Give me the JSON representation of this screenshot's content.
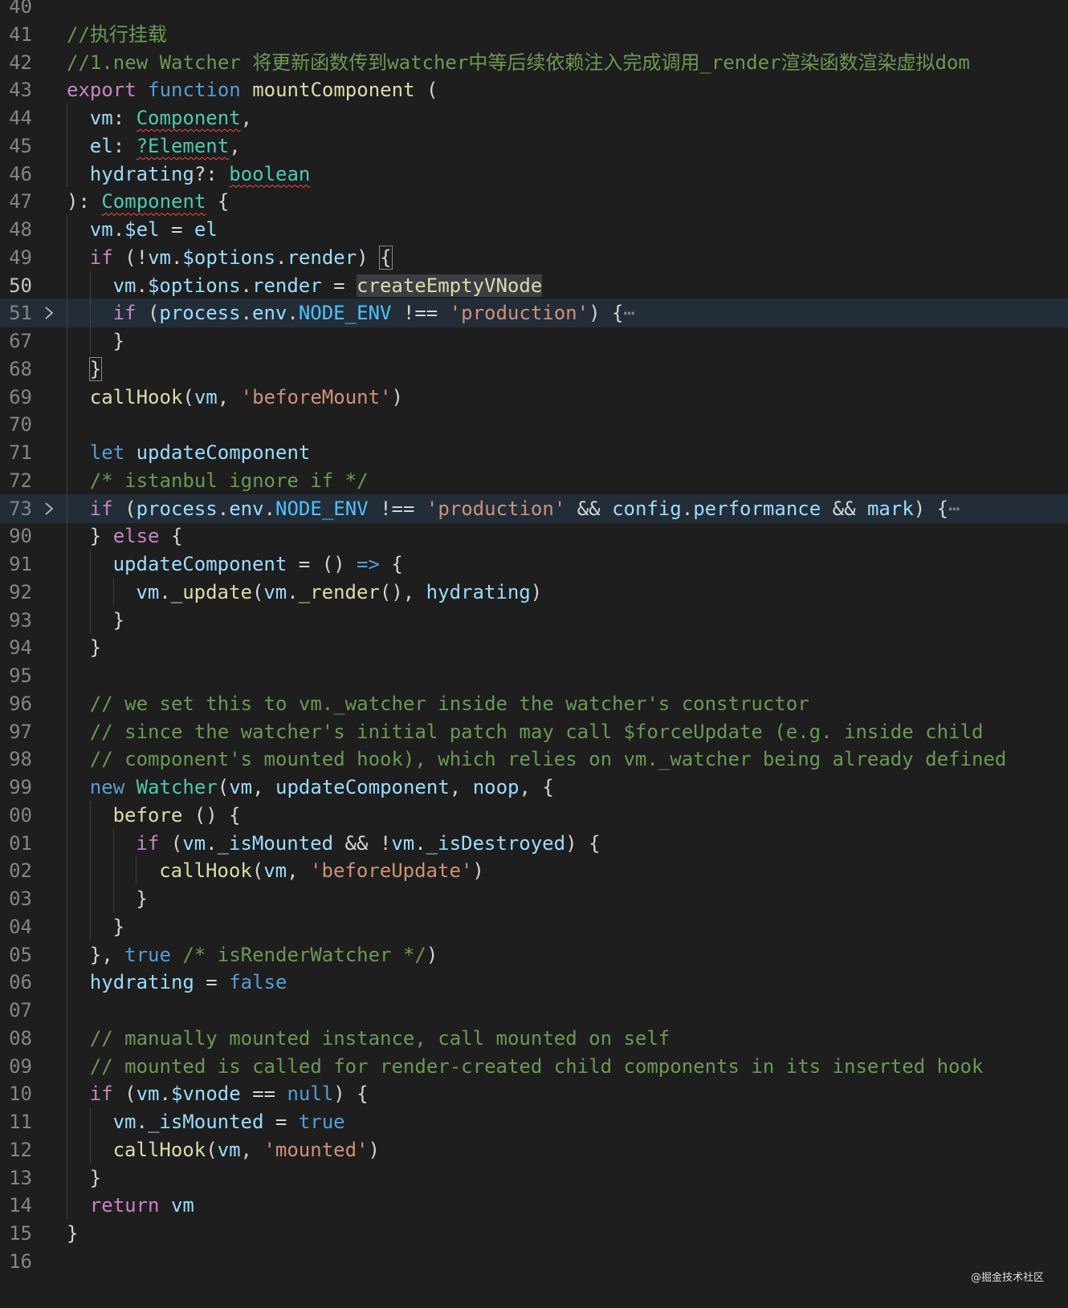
{
  "editor": {
    "lines": [
      {
        "n": "40",
        "indent": 0,
        "tokens": []
      },
      {
        "n": "41",
        "indent": 0,
        "tokens": [
          [
            "cmt",
            "//执行挂载"
          ]
        ]
      },
      {
        "n": "42",
        "indent": 0,
        "tokens": [
          [
            "cmt",
            "//1.new Watcher 将更新函数传到watcher中等后续依赖注入完成调用_render渲染函数渲染虚拟dom"
          ]
        ]
      },
      {
        "n": "43",
        "indent": 0,
        "tokens": [
          [
            "kw",
            "export"
          ],
          [
            "p",
            " "
          ],
          [
            "bkw",
            "function"
          ],
          [
            "p",
            " "
          ],
          [
            "fn",
            "mountComponent"
          ],
          [
            "p",
            " ("
          ]
        ]
      },
      {
        "n": "44",
        "indent": 1,
        "tokens": [
          [
            "var",
            "vm"
          ],
          [
            "p",
            ": "
          ],
          [
            "typ squig",
            "Component"
          ],
          [
            "p",
            ","
          ]
        ]
      },
      {
        "n": "45",
        "indent": 1,
        "tokens": [
          [
            "var",
            "el"
          ],
          [
            "p",
            ": "
          ],
          [
            "typ squig",
            "?Element"
          ],
          [
            "p",
            ","
          ]
        ]
      },
      {
        "n": "46",
        "indent": 1,
        "tokens": [
          [
            "var",
            "hydrating"
          ],
          [
            "p",
            "?: "
          ],
          [
            "typ squig",
            "boolean"
          ]
        ]
      },
      {
        "n": "47",
        "indent": 0,
        "tokens": [
          [
            "p",
            "): "
          ],
          [
            "typ squig",
            "Component"
          ],
          [
            "p",
            " {"
          ]
        ]
      },
      {
        "n": "48",
        "indent": 1,
        "tokens": [
          [
            "var",
            "vm"
          ],
          [
            "p",
            "."
          ],
          [
            "var",
            "$el"
          ],
          [
            "p",
            " = "
          ],
          [
            "var",
            "el"
          ]
        ]
      },
      {
        "n": "49",
        "indent": 1,
        "tokens": [
          [
            "kw",
            "if"
          ],
          [
            "p",
            " (!"
          ],
          [
            "var",
            "vm"
          ],
          [
            "p",
            "."
          ],
          [
            "var",
            "$options"
          ],
          [
            "p",
            "."
          ],
          [
            "var",
            "render"
          ],
          [
            "p",
            ") "
          ],
          [
            "brk",
            "{"
          ]
        ]
      },
      {
        "n": "50",
        "indent": 2,
        "cur": true,
        "tokens": [
          [
            "var",
            "vm"
          ],
          [
            "p",
            "."
          ],
          [
            "var",
            "$options"
          ],
          [
            "p",
            "."
          ],
          [
            "var",
            "render"
          ],
          [
            "p",
            " = "
          ],
          [
            "fn selhl",
            "createEmptyVNode"
          ]
        ]
      },
      {
        "n": "51",
        "indent": 2,
        "hl": true,
        "fold": true,
        "tokens": [
          [
            "kw",
            "if"
          ],
          [
            "p",
            " ("
          ],
          [
            "var",
            "process"
          ],
          [
            "p",
            "."
          ],
          [
            "var",
            "env"
          ],
          [
            "p",
            "."
          ],
          [
            "const",
            "NODE_ENV"
          ],
          [
            "p",
            " !== "
          ],
          [
            "str",
            "'production'"
          ],
          [
            "p",
            ") {"
          ],
          [
            "ell",
            "⋯"
          ]
        ]
      },
      {
        "n": "67",
        "indent": 2,
        "tokens": [
          [
            "p",
            "}"
          ]
        ]
      },
      {
        "n": "68",
        "indent": 1,
        "tokens": [
          [
            "brk",
            "}"
          ]
        ]
      },
      {
        "n": "69",
        "indent": 1,
        "tokens": [
          [
            "fn",
            "callHook"
          ],
          [
            "p",
            "("
          ],
          [
            "var",
            "vm"
          ],
          [
            "p",
            ", "
          ],
          [
            "str",
            "'beforeMount'"
          ],
          [
            "p",
            ")"
          ]
        ]
      },
      {
        "n": "70",
        "indent": 1,
        "tokens": []
      },
      {
        "n": "71",
        "indent": 1,
        "tokens": [
          [
            "bkw",
            "let"
          ],
          [
            "p",
            " "
          ],
          [
            "var",
            "updateComponent"
          ]
        ]
      },
      {
        "n": "72",
        "indent": 1,
        "tokens": [
          [
            "cmt",
            "/* istanbul ignore if */"
          ]
        ]
      },
      {
        "n": "73",
        "indent": 1,
        "hl": true,
        "fold": true,
        "tokens": [
          [
            "kw",
            "if"
          ],
          [
            "p",
            " ("
          ],
          [
            "var",
            "process"
          ],
          [
            "p",
            "."
          ],
          [
            "var",
            "env"
          ],
          [
            "p",
            "."
          ],
          [
            "const",
            "NODE_ENV"
          ],
          [
            "p",
            " !== "
          ],
          [
            "str",
            "'production'"
          ],
          [
            "p",
            " && "
          ],
          [
            "var",
            "config"
          ],
          [
            "p",
            "."
          ],
          [
            "var",
            "performance"
          ],
          [
            "p",
            " && "
          ],
          [
            "var",
            "mark"
          ],
          [
            "p",
            ") {"
          ],
          [
            "ell",
            "⋯"
          ]
        ]
      },
      {
        "n": "90",
        "indent": 1,
        "tokens": [
          [
            "p",
            "} "
          ],
          [
            "kw",
            "else"
          ],
          [
            "p",
            " {"
          ]
        ]
      },
      {
        "n": "91",
        "indent": 2,
        "tokens": [
          [
            "var",
            "updateComponent"
          ],
          [
            "p",
            " = () "
          ],
          [
            "bkw",
            "=>"
          ],
          [
            "p",
            " {"
          ]
        ]
      },
      {
        "n": "92",
        "indent": 3,
        "tokens": [
          [
            "var",
            "vm"
          ],
          [
            "p",
            "."
          ],
          [
            "fn",
            "_update"
          ],
          [
            "p",
            "("
          ],
          [
            "var",
            "vm"
          ],
          [
            "p",
            "."
          ],
          [
            "fn",
            "_render"
          ],
          [
            "p",
            "(), "
          ],
          [
            "var",
            "hydrating"
          ],
          [
            "p",
            ")"
          ]
        ]
      },
      {
        "n": "93",
        "indent": 2,
        "tokens": [
          [
            "p",
            "}"
          ]
        ]
      },
      {
        "n": "94",
        "indent": 1,
        "tokens": [
          [
            "p",
            "}"
          ]
        ]
      },
      {
        "n": "95",
        "indent": 1,
        "tokens": []
      },
      {
        "n": "96",
        "indent": 1,
        "tokens": [
          [
            "cmt",
            "// we set this to vm._watcher inside the watcher's constructor"
          ]
        ]
      },
      {
        "n": "97",
        "indent": 1,
        "tokens": [
          [
            "cmt",
            "// since the watcher's initial patch may call $forceUpdate (e.g. inside child"
          ]
        ]
      },
      {
        "n": "98",
        "indent": 1,
        "tokens": [
          [
            "cmt",
            "// component's mounted hook), which relies on vm._watcher being already defined"
          ]
        ]
      },
      {
        "n": "99",
        "indent": 1,
        "tokens": [
          [
            "bkw",
            "new"
          ],
          [
            "p",
            " "
          ],
          [
            "typ",
            "Watcher"
          ],
          [
            "p",
            "("
          ],
          [
            "var",
            "vm"
          ],
          [
            "p",
            ", "
          ],
          [
            "var",
            "updateComponent"
          ],
          [
            "p",
            ", "
          ],
          [
            "var",
            "noop"
          ],
          [
            "p",
            ", {"
          ]
        ]
      },
      {
        "n": "00",
        "indent": 2,
        "tokens": [
          [
            "fn",
            "before"
          ],
          [
            "p",
            " () {"
          ]
        ]
      },
      {
        "n": "01",
        "indent": 3,
        "tokens": [
          [
            "kw",
            "if"
          ],
          [
            "p",
            " ("
          ],
          [
            "var",
            "vm"
          ],
          [
            "p",
            "."
          ],
          [
            "var",
            "_isMounted"
          ],
          [
            "p",
            " && !"
          ],
          [
            "var",
            "vm"
          ],
          [
            "p",
            "."
          ],
          [
            "var",
            "_isDestroyed"
          ],
          [
            "p",
            ") {"
          ]
        ]
      },
      {
        "n": "02",
        "indent": 4,
        "tokens": [
          [
            "fn",
            "callHook"
          ],
          [
            "p",
            "("
          ],
          [
            "var",
            "vm"
          ],
          [
            "p",
            ", "
          ],
          [
            "str",
            "'beforeUpdate'"
          ],
          [
            "p",
            ")"
          ]
        ]
      },
      {
        "n": "03",
        "indent": 3,
        "tokens": [
          [
            "p",
            "}"
          ]
        ]
      },
      {
        "n": "04",
        "indent": 2,
        "tokens": [
          [
            "p",
            "}"
          ]
        ]
      },
      {
        "n": "05",
        "indent": 1,
        "tokens": [
          [
            "p",
            "}, "
          ],
          [
            "bkw",
            "true"
          ],
          [
            "p",
            " "
          ],
          [
            "cmt",
            "/* isRenderWatcher */"
          ],
          [
            "p",
            ")"
          ]
        ]
      },
      {
        "n": "06",
        "indent": 1,
        "tokens": [
          [
            "var",
            "hydrating"
          ],
          [
            "p",
            " = "
          ],
          [
            "bkw",
            "false"
          ]
        ]
      },
      {
        "n": "07",
        "indent": 1,
        "tokens": []
      },
      {
        "n": "08",
        "indent": 1,
        "tokens": [
          [
            "cmt",
            "// manually mounted instance, call mounted on self"
          ]
        ]
      },
      {
        "n": "09",
        "indent": 1,
        "tokens": [
          [
            "cmt",
            "// mounted is called for render-created child components in its inserted hook"
          ]
        ]
      },
      {
        "n": "10",
        "indent": 1,
        "tokens": [
          [
            "kw",
            "if"
          ],
          [
            "p",
            " ("
          ],
          [
            "var",
            "vm"
          ],
          [
            "p",
            "."
          ],
          [
            "var",
            "$vnode"
          ],
          [
            "p",
            " == "
          ],
          [
            "bkw",
            "null"
          ],
          [
            "p",
            ") {"
          ]
        ]
      },
      {
        "n": "11",
        "indent": 2,
        "tokens": [
          [
            "var",
            "vm"
          ],
          [
            "p",
            "."
          ],
          [
            "var",
            "_isMounted"
          ],
          [
            "p",
            " = "
          ],
          [
            "bkw",
            "true"
          ]
        ]
      },
      {
        "n": "12",
        "indent": 2,
        "tokens": [
          [
            "fn",
            "callHook"
          ],
          [
            "p",
            "("
          ],
          [
            "var",
            "vm"
          ],
          [
            "p",
            ", "
          ],
          [
            "str",
            "'mounted'"
          ],
          [
            "p",
            ")"
          ]
        ]
      },
      {
        "n": "13",
        "indent": 1,
        "tokens": [
          [
            "p",
            "}"
          ]
        ]
      },
      {
        "n": "14",
        "indent": 1,
        "tokens": [
          [
            "kw",
            "return"
          ],
          [
            "p",
            " "
          ],
          [
            "var",
            "vm"
          ]
        ]
      },
      {
        "n": "15",
        "indent": 0,
        "tokens": [
          [
            "p",
            "}"
          ]
        ]
      },
      {
        "n": "16",
        "indent": 0,
        "tokens": []
      }
    ]
  },
  "watermark": "@掘金技术社区"
}
